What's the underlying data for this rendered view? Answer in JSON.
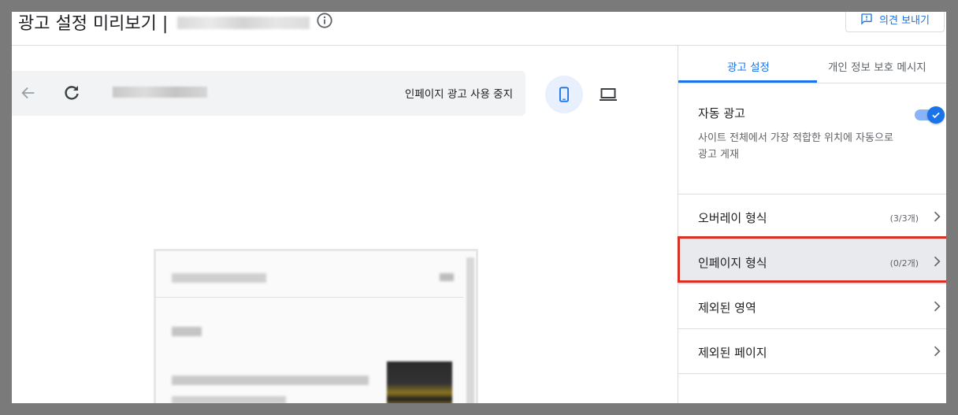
{
  "header": {
    "title": "광고 설정 미리보기 |",
    "feedback_label": "의견 보내기",
    "icons": {
      "info": "info-icon",
      "feedback": "feedback-icon"
    }
  },
  "preview": {
    "stop_ads_label": "인페이지 광고 사용 중지",
    "icons": {
      "back": "arrow-left-icon",
      "refresh": "refresh-icon",
      "mobile": "smartphone-icon",
      "desktop": "laptop-icon"
    },
    "active_device": "mobile"
  },
  "panel": {
    "tabs": [
      {
        "label": "광고 설정",
        "active": true
      },
      {
        "label": "개인 정보 보호 메시지",
        "active": false
      }
    ],
    "auto_ads": {
      "title": "자동 광고",
      "description": "사이트 전체에서 가장 적합한 위치에 자동으로 광고 게재",
      "enabled": true
    },
    "rows": [
      {
        "label": "오버레이 형식",
        "count": "(3/3개)"
      },
      {
        "label": "인페이지 형식",
        "count": "(0/2개)"
      },
      {
        "label": "제외된 영역",
        "count": ""
      },
      {
        "label": "제외된 페이지",
        "count": ""
      }
    ]
  },
  "colors": {
    "accent": "#1a73e8",
    "overlay": "#7a7a7a",
    "highlight_border": "#d93025",
    "toggle_track": "#8ab4f8"
  }
}
